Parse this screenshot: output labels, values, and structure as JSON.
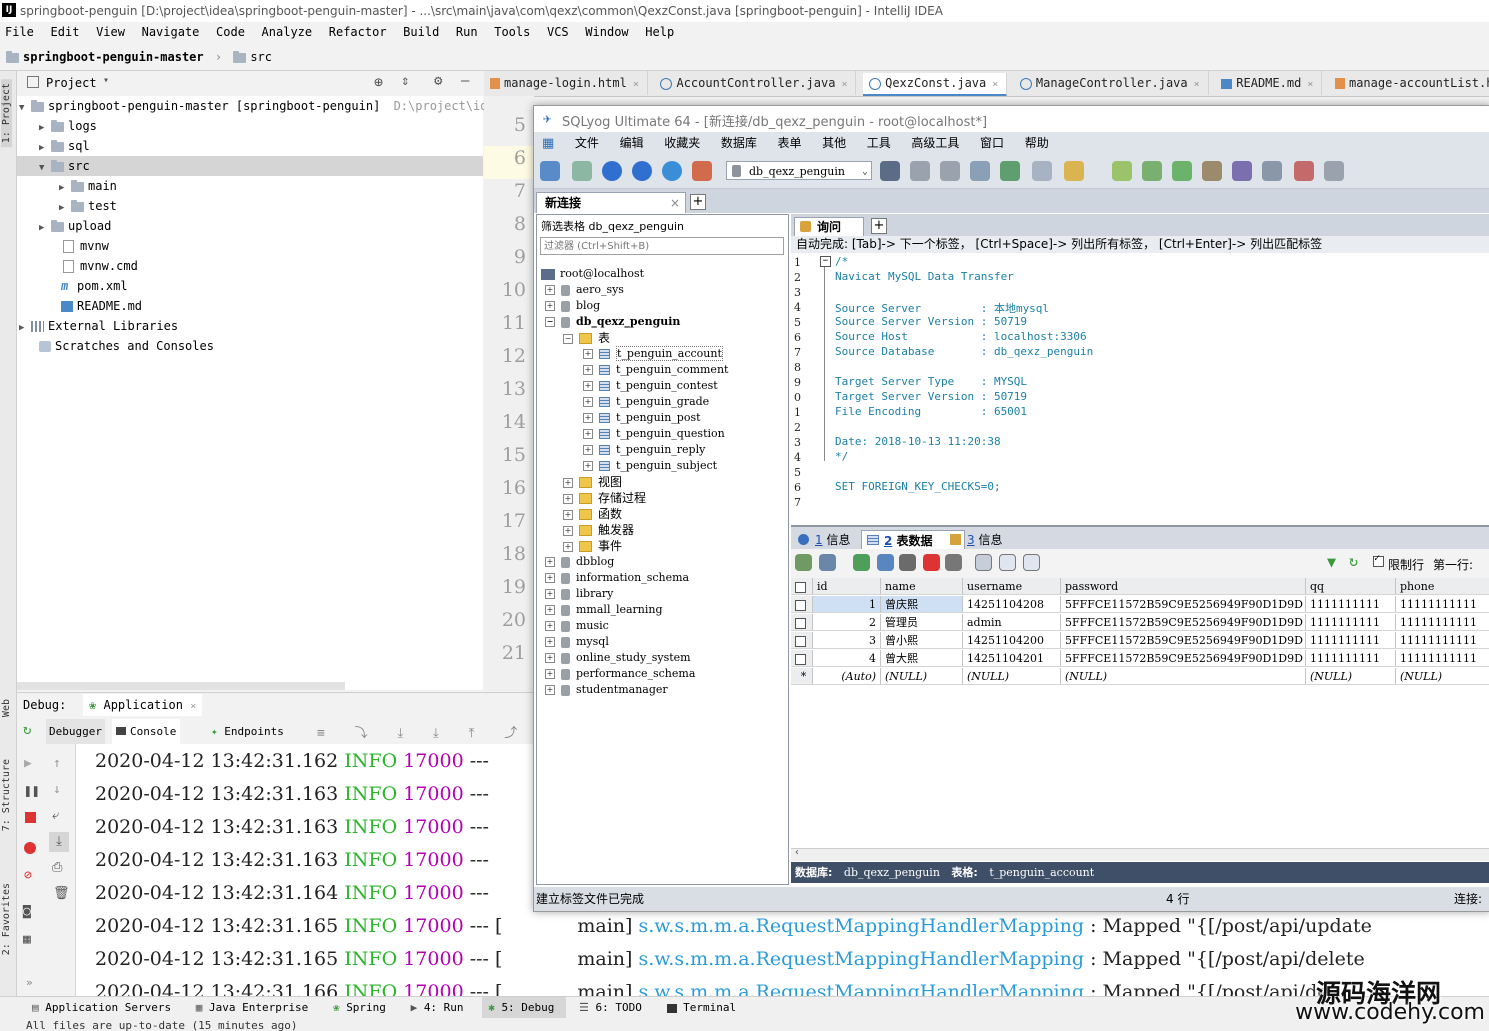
{
  "ide": {
    "title": "springboot-penguin [D:\\project\\idea\\springboot-penguin-master] - ...\\src\\main\\java\\com\\qexz\\common\\QexzConst.java [springboot-penguin] - IntelliJ IDEA",
    "menu": [
      "File",
      "Edit",
      "View",
      "Navigate",
      "Code",
      "Analyze",
      "Refactor",
      "Build",
      "Run",
      "Tools",
      "VCS",
      "Window",
      "Help"
    ],
    "breadcrumb": [
      "springboot-penguin-master",
      "src"
    ],
    "left_stripe": [
      "1: Project",
      "Web",
      "7: Structure",
      "2: Favorites"
    ],
    "project": {
      "label": "Project",
      "root_name": "springboot-penguin-master [springboot-penguin]",
      "root_path": "D:\\project\\ide",
      "items": [
        {
          "label": "logs"
        },
        {
          "label": "sql"
        },
        {
          "label": "src"
        },
        {
          "label": "main"
        },
        {
          "label": "test"
        },
        {
          "label": "upload"
        },
        {
          "label": "mvnw"
        },
        {
          "label": "mvnw.cmd"
        },
        {
          "label": "pom.xml"
        },
        {
          "label": "README.md"
        },
        {
          "label": "External Libraries"
        },
        {
          "label": "Scratches and Consoles"
        }
      ]
    },
    "editor_tabs": [
      {
        "label": "manage-login.html"
      },
      {
        "label": "AccountController.java"
      },
      {
        "label": "QexzConst.java"
      },
      {
        "label": "ManageController.java"
      },
      {
        "label": "README.md"
      },
      {
        "label": "manage-accountList.html"
      }
    ],
    "line_numbers": [
      "5",
      "6",
      "7",
      "8",
      "9",
      "10",
      "11",
      "12",
      "13",
      "14",
      "15",
      "16",
      "17",
      "18",
      "19",
      "20",
      "21"
    ],
    "debug": {
      "label": "Debug:",
      "config": "Application",
      "tabs": [
        "Debugger",
        "Console",
        "Endpoints"
      ]
    },
    "console_lines": [
      {
        "ts": "2020-04-12 13:42:31.162",
        "level": "INFO",
        "pid": "17000",
        "sep": "---",
        "rest": ""
      },
      {
        "ts": "2020-04-12 13:42:31.163",
        "level": "INFO",
        "pid": "17000",
        "sep": "---",
        "rest": ""
      },
      {
        "ts": "2020-04-12 13:42:31.163",
        "level": "INFO",
        "pid": "17000",
        "sep": "---",
        "rest": ""
      },
      {
        "ts": "2020-04-12 13:42:31.163",
        "level": "INFO",
        "pid": "17000",
        "sep": "---",
        "rest": ""
      },
      {
        "ts": "2020-04-12 13:42:31.164",
        "level": "INFO",
        "pid": "17000",
        "sep": "---",
        "rest": ""
      },
      {
        "ts": "2020-04-12 13:42:31.165",
        "level": "INFO",
        "pid": "17000",
        "sep": "--- [",
        "thread": "main]",
        "cls": "s.w.s.m.m.a.RequestMappingHandlerMapping",
        "tail": ": Mapped \"{[/post/api/update"
      },
      {
        "ts": "2020-04-12 13:42:31.165",
        "level": "INFO",
        "pid": "17000",
        "sep": "--- [",
        "thread": "main]",
        "cls": "s.w.s.m.m.a.RequestMappingHandlerMapping",
        "tail": ": Mapped \"{[/post/api/delete"
      },
      {
        "ts": "2020-04-12 13:42:31.166",
        "level": "INFO",
        "pid": "17000",
        "sep": "--- [",
        "thread": "main]",
        "cls": "s.w.s.m.m.a.RequestMappingHandlerMapping",
        "tail": ": Mapped \"{[/post/api/de"
      }
    ],
    "bottom_tabs": [
      "Application Servers",
      "Java Enterprise",
      "Spring",
      "4: Run",
      "5: Debug",
      "6: TODO",
      "Terminal"
    ],
    "status": "All files are up-to-date (15 minutes ago)"
  },
  "sqlyog": {
    "title": "SQLyog Ultimate 64 - [新连接/db_qexz_penguin - root@localhost*]",
    "menu": [
      "文件",
      "编辑",
      "收藏夹",
      "数据库",
      "表单",
      "其他",
      "工具",
      "高级工具",
      "窗口",
      "帮助"
    ],
    "db_selector": "db_qexz_penguin",
    "connection_tab": "新连接",
    "filter_label": "筛选表格 db_qexz_penguin",
    "filter_placeholder": "过滤器 (Ctrl+Shift+B)",
    "tree": {
      "root": "root@localhost",
      "databases_before": [
        "aero_sys",
        "blog"
      ],
      "active_db": "db_qexz_penguin",
      "tables_folder": "表",
      "tables": [
        "t_penguin_account",
        "t_penguin_comment",
        "t_penguin_contest",
        "t_penguin_grade",
        "t_penguin_post",
        "t_penguin_question",
        "t_penguin_reply",
        "t_penguin_subject"
      ],
      "folders": [
        "视图",
        "存储过程",
        "函数",
        "触发器",
        "事件"
      ],
      "databases_after": [
        "dbblog",
        "information_schema",
        "library",
        "mmall_learning",
        "music",
        "mysql",
        "online_study_system",
        "performance_schema",
        "studentmanager"
      ]
    },
    "query_tab": "询问",
    "autocomplete": "自动完成:  [Tab]-> 下一个标签，  [Ctrl+Space]-> 列出所有标签，  [Ctrl+Enter]-> 列出匹配标签",
    "query_lines": [
      {
        "n": "1",
        "text": "/*"
      },
      {
        "n": "2",
        "text": "Navicat MySQL Data Transfer"
      },
      {
        "n": "3",
        "text": ""
      },
      {
        "n": "4",
        "text": "Source Server         : 本地mysql"
      },
      {
        "n": "5",
        "text": "Source Server Version : 50719"
      },
      {
        "n": "6",
        "text": "Source Host           : localhost:3306"
      },
      {
        "n": "7",
        "text": "Source Database       : db_qexz_penguin"
      },
      {
        "n": "8",
        "text": ""
      },
      {
        "n": "9",
        "text": "Target Server Type    : MYSQL"
      },
      {
        "n": "0",
        "text": "Target Server Version : 50719"
      },
      {
        "n": "1",
        "text": "File Encoding         : 65001"
      },
      {
        "n": "2",
        "text": ""
      },
      {
        "n": "3",
        "text": "Date: 2018-10-13 11:20:38"
      },
      {
        "n": "4",
        "text": "*/"
      },
      {
        "n": "5",
        "text": ""
      },
      {
        "n": "6",
        "text": "SET FOREIGN_KEY_CHECKS=0;"
      },
      {
        "n": "7",
        "text": ""
      }
    ],
    "result_tabs": [
      {
        "num": "1",
        "label": "信息"
      },
      {
        "num": "2",
        "label": "表数据"
      },
      {
        "num": "3",
        "label": "信息"
      }
    ],
    "result_toolbar": {
      "limit_label": "限制行",
      "first_row_label": "第一行:"
    },
    "grid": {
      "columns": [
        "id",
        "name",
        "username",
        "password",
        "qq",
        "phone"
      ],
      "rows": [
        [
          "1",
          "曾庆熙",
          "14251104208",
          "5FFFCE11572B59C9E5256949F90D1D9D",
          "1111111111",
          "11111111111"
        ],
        [
          "2",
          "管理员",
          "admin",
          "5FFFCE11572B59C9E5256949F90D1D9D",
          "1111111111",
          "11111111111"
        ],
        [
          "3",
          "曾小熙",
          "14251104200",
          "5FFFCE11572B59C9E5256949F90D1D9D",
          "1111111111",
          "11111111111"
        ],
        [
          "4",
          "曾大熙",
          "14251104201",
          "5FFFCE11572B59C9E5256949F90D1D9D",
          "1111111111",
          "11111111111"
        ]
      ],
      "new_row": [
        "(Auto)",
        "(NULL)",
        "(NULL)",
        "(NULL)",
        "(NULL)",
        "(NULL)"
      ],
      "new_row_marker": "*"
    },
    "info_bar": {
      "db_label": "数据库:",
      "db": "db_qexz_penguin",
      "table_label": "表格:",
      "table": "t_penguin_account"
    },
    "status": {
      "left": "建立标签文件已完成",
      "rows": "4 行",
      "conn": "连接:"
    }
  },
  "watermark": {
    "line1": "源码海洋网",
    "line2": "www.codehy.com"
  },
  "colors": {
    "accent": "#4a88c7",
    "info_green": "#2ab52a",
    "pid_purple": "#b400b4",
    "class_blue": "#2a9bd8",
    "selected_row": "#cfe0f5"
  }
}
